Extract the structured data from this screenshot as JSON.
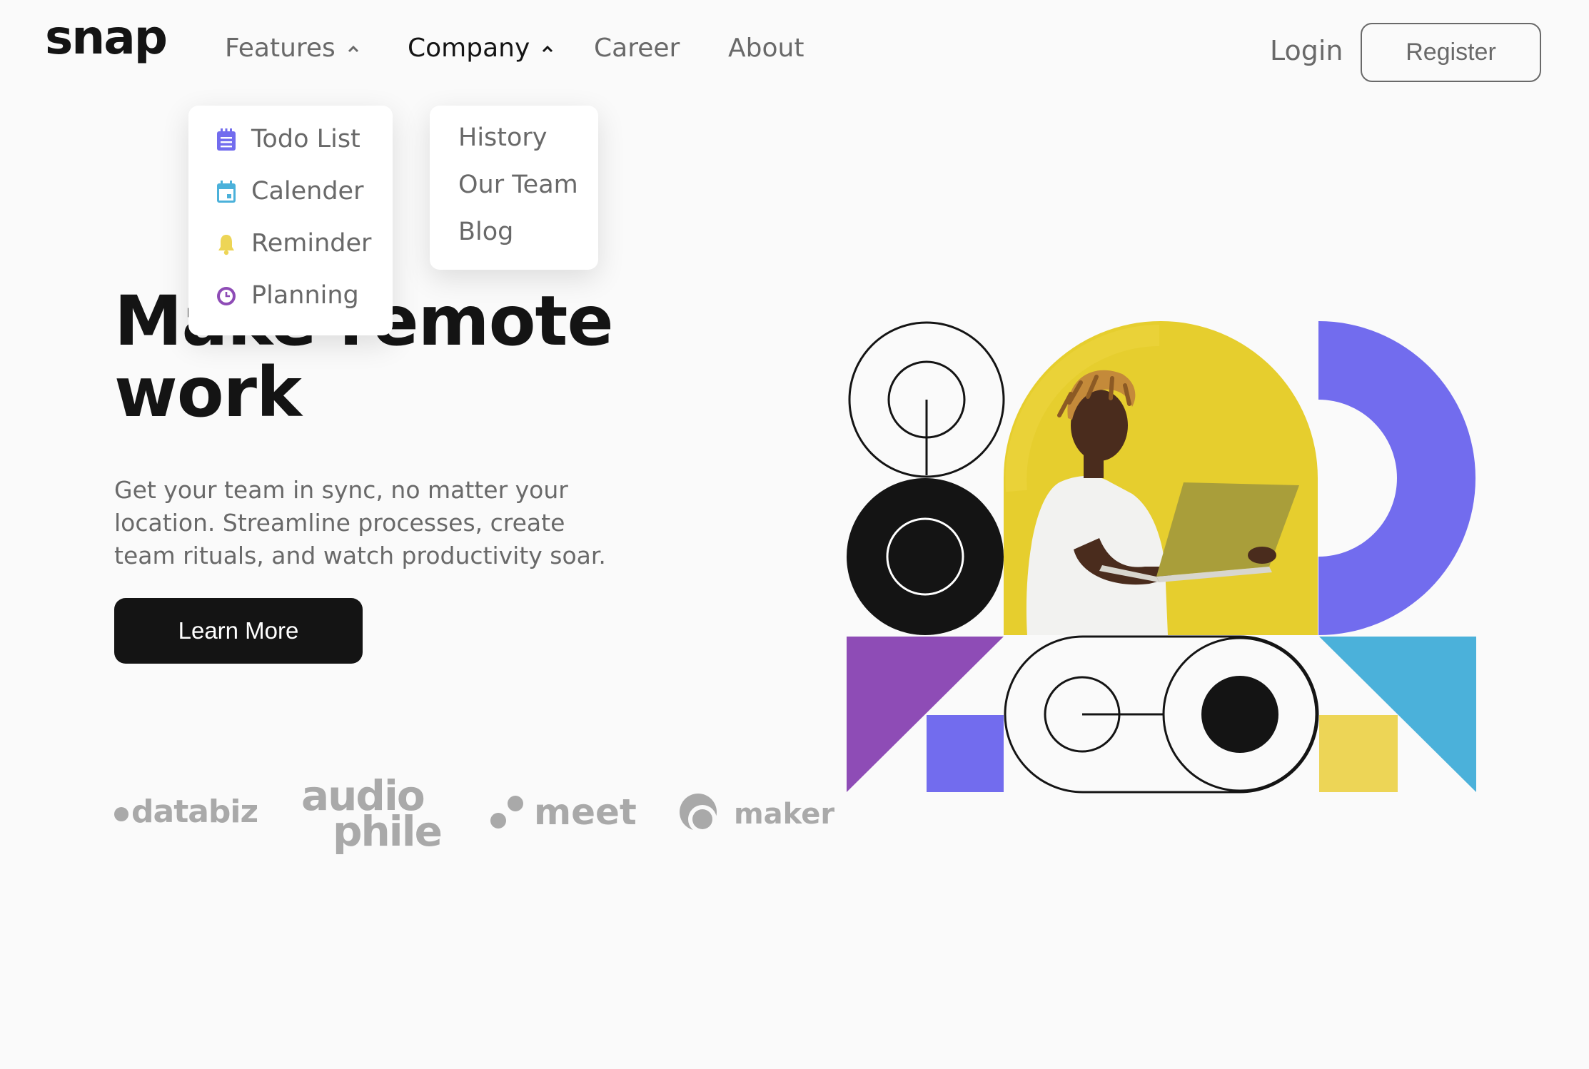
{
  "header": {
    "logo": "snap",
    "nav": [
      {
        "label": "Features"
      },
      {
        "label": "Company"
      },
      {
        "label": "Career"
      },
      {
        "label": "About"
      }
    ],
    "login_label": "Login",
    "register_label": "Register"
  },
  "features_menu": {
    "items": [
      {
        "label": "Todo List",
        "icon": "todo-icon",
        "color": "#726CEE"
      },
      {
        "label": "Calender",
        "icon": "calendar-icon",
        "color": "#4BB1DA"
      },
      {
        "label": "Reminder",
        "icon": "bell-icon",
        "color": "#EDD556"
      },
      {
        "label": "Planning",
        "icon": "clock-icon",
        "color": "#8E4CB6"
      }
    ]
  },
  "company_menu": {
    "items": [
      {
        "label": "History"
      },
      {
        "label": "Our Team"
      },
      {
        "label": "Blog"
      }
    ]
  },
  "hero": {
    "title_line1": "Make remote",
    "title_line2": "work",
    "description": "Get your team in sync, no matter your location. Streamline processes, create team rituals, and watch productivity soar.",
    "cta_label": "Learn More"
  },
  "clients": {
    "databiz": "databiz",
    "audiophile_line1": "audio",
    "audiophile_line2": "phile",
    "meet": "meet",
    "maker": "maker"
  },
  "colors": {
    "text_dark": "#141414",
    "text_gray": "#696969",
    "background": "#fafafa",
    "accent_blue_violet": "#726CEE",
    "accent_purple": "#8E4CB6",
    "accent_sky": "#4BB1DA",
    "accent_yellow": "#EDD556"
  }
}
